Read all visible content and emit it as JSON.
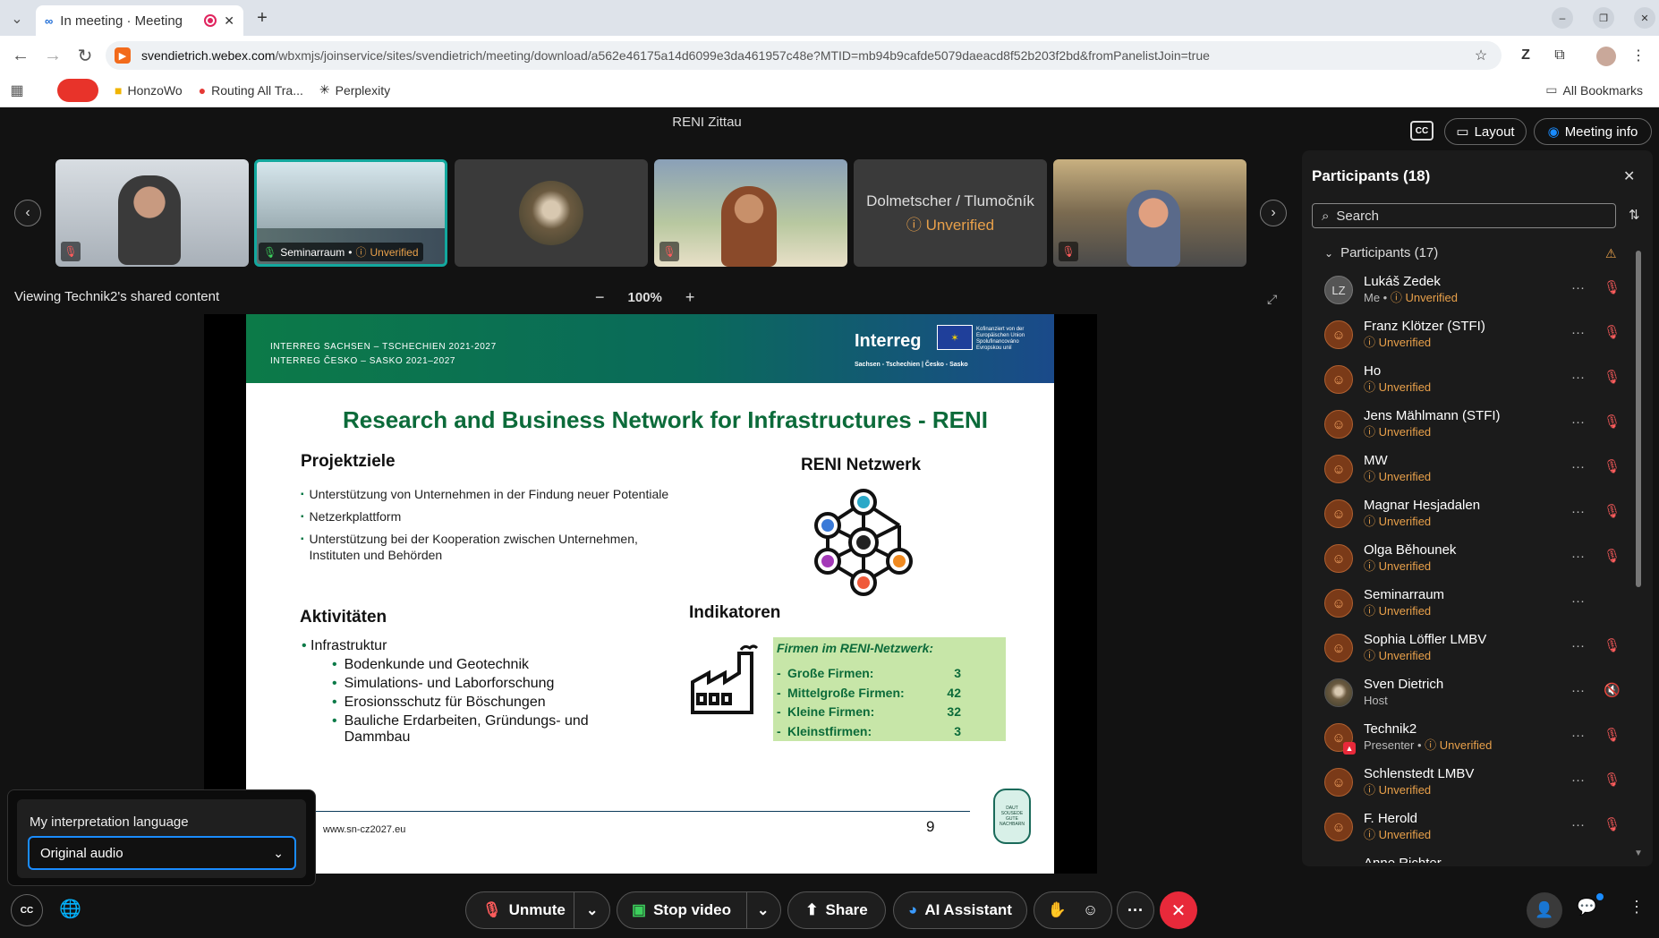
{
  "browser": {
    "tab_title": "In meeting · Meeting",
    "url_domain": "svendietrich.webex.com",
    "url_path": "/wbxmjs/joinservice/sites/svendietrich/meeting/download/a562e46175a14d6099e3da461957c48e?MTID=mb94b9cafde5079daeacd8f52b203f2bd&fromPanelistJoin=true",
    "bookmarks": [
      "HonzoWo",
      "Routing All Tra...",
      "Perplexity"
    ],
    "all_bookmarks": "All Bookmarks"
  },
  "meeting": {
    "title": "RENI Zittau",
    "layout_label": "Layout",
    "info_label": "Meeting info",
    "viewing": "Viewing Technik2's shared content",
    "zoom": "100%",
    "thumbnails": [
      {
        "label": ""
      },
      {
        "label": "Seminarraum",
        "status": "Unverified"
      },
      {
        "label": ""
      },
      {
        "label": ""
      },
      {
        "label": "Dolmetscher / Tlumočník",
        "status": "Unverified"
      },
      {
        "label": ""
      }
    ]
  },
  "slide": {
    "header_line1": "INTERREG SACHSEN – TSCHECHIEN 2021-2027",
    "header_line2": "INTERREG ČESKO – SASKO 2021–2027",
    "logo": "Interreg",
    "logo_sub": "Sachsen - Tschechien | Česko - Sasko",
    "eu_text": "Kofinanziert von der Europäischen Union Spolufinancováno Evropskou unií",
    "title": "Research and Business Network for Infrastructures - RENI",
    "projektziele_heading": "Projektziele",
    "projektziele": [
      "Unterstützung von Unternehmen in der Findung neuer Potentiale",
      "Netzerkplattform",
      "Unterstützung bei der Kooperation zwischen Unternehmen, Instituten und Behörden"
    ],
    "netzwerk_heading": "RENI Netzwerk",
    "aktivitaeten_heading": "Aktivitäten",
    "aktivitaeten_main": "Infrastruktur",
    "aktivitaeten_sub": [
      "Bodenkunde und Geotechnik",
      "Simulations- und Laborforschung",
      "Erosionsschutz für Böschungen",
      "Bauliche Erdarbeiten, Gründungs- und Dammbau"
    ],
    "indikatoren_heading": "Indikatoren",
    "firmen_heading": "Firmen im RENI-Netzwerk:",
    "firmen": [
      {
        "label": "Große Firmen:",
        "value": "3"
      },
      {
        "label": "Mittelgroße Firmen:",
        "value": "42"
      },
      {
        "label": "Kleine Firmen:",
        "value": "32"
      },
      {
        "label": "Kleinstfirmen:",
        "value": "3"
      }
    ],
    "footer_url": "www.sn-cz2027.eu",
    "page_number": "9",
    "stamp_top": "DAUT SOUSEDE",
    "stamp_bottom": "GUTE NACHBARN"
  },
  "interpretation": {
    "heading": "My interpretation language",
    "selected": "Original audio"
  },
  "participants": {
    "title": "Participants (18)",
    "search_placeholder": "Search",
    "group_label": "Participants (17)",
    "list": [
      {
        "name": "Lukáš Zedek",
        "initials": "LZ",
        "role": "Me",
        "status": "Unverified"
      },
      {
        "name": "Franz Klötzer (STFI)",
        "role": "",
        "status": "Unverified"
      },
      {
        "name": "Ho",
        "role": "",
        "status": "Unverified"
      },
      {
        "name": "Jens Mählmann (STFI)",
        "role": "",
        "status": "Unverified"
      },
      {
        "name": "MW",
        "role": "",
        "status": "Unverified"
      },
      {
        "name": "Magnar Hesjadalen",
        "role": "",
        "status": "Unverified"
      },
      {
        "name": "Olga Běhounek",
        "role": "",
        "status": "Unverified"
      },
      {
        "name": "Seminarraum",
        "role": "",
        "status": "Unverified"
      },
      {
        "name": "Sophia Löffler LMBV",
        "role": "",
        "status": "Unverified"
      },
      {
        "name": "Sven Dietrich",
        "role": "Host",
        "status": ""
      },
      {
        "name": "Technik2",
        "role": "Presenter",
        "status": "Unverified"
      },
      {
        "name": "Schlenstedt LMBV",
        "role": "",
        "status": "Unverified"
      },
      {
        "name": "F. Herold",
        "role": "",
        "status": "Unverified"
      },
      {
        "name": "Anne Richter",
        "role": "",
        "status": ""
      }
    ]
  },
  "controls": {
    "unmute": "Unmute",
    "stop_video": "Stop video",
    "share": "Share",
    "ai_assistant": "AI Assistant"
  },
  "colors": {
    "accent_blue": "#1a8cff",
    "warning": "#e8a04a",
    "danger": "#e8293a",
    "slide_green": "#0c7a48",
    "indikator_bg": "#c7e6a8"
  }
}
